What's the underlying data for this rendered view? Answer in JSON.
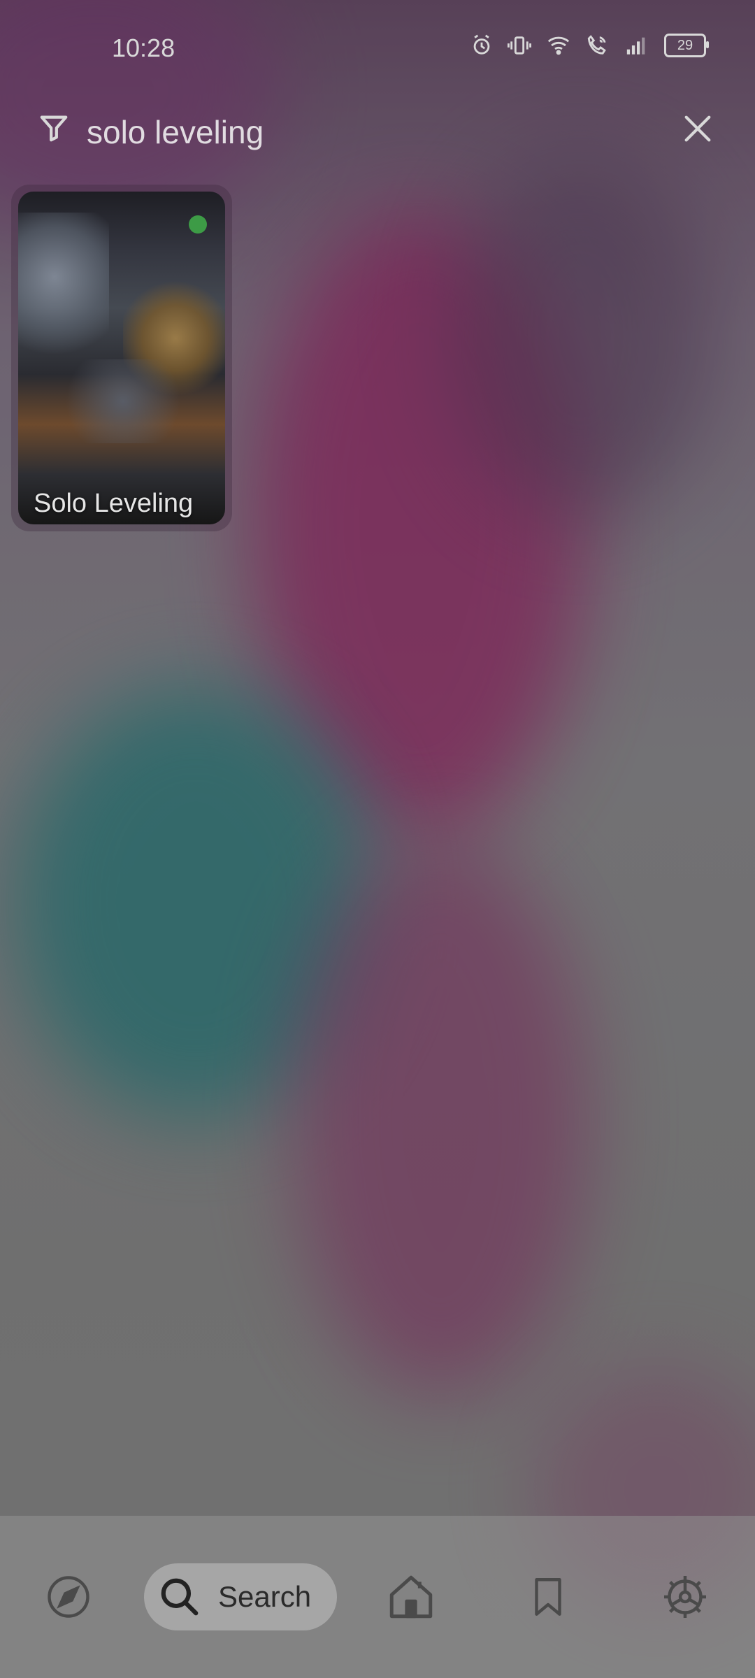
{
  "status_bar": {
    "time": "10:28",
    "battery": "29",
    "icons": [
      "alarm-icon",
      "vibrate-icon",
      "wifi-icon",
      "wifi-calling-icon",
      "signal-icon",
      "battery-icon"
    ]
  },
  "search": {
    "query": "solo leveling",
    "icons": [
      "filter-icon",
      "close-icon"
    ]
  },
  "results": [
    {
      "title": "Solo Leveling",
      "status_dot_color": "#3d9b46"
    }
  ],
  "bottom_nav": {
    "items": [
      {
        "id": "explore",
        "icon": "compass-icon",
        "label": ""
      },
      {
        "id": "search",
        "icon": "search-icon",
        "label": "Search",
        "active": true
      },
      {
        "id": "home",
        "icon": "home-icon",
        "label": ""
      },
      {
        "id": "bookmarks",
        "icon": "bookmark-icon",
        "label": ""
      },
      {
        "id": "settings",
        "icon": "settings-icon",
        "label": ""
      }
    ]
  }
}
